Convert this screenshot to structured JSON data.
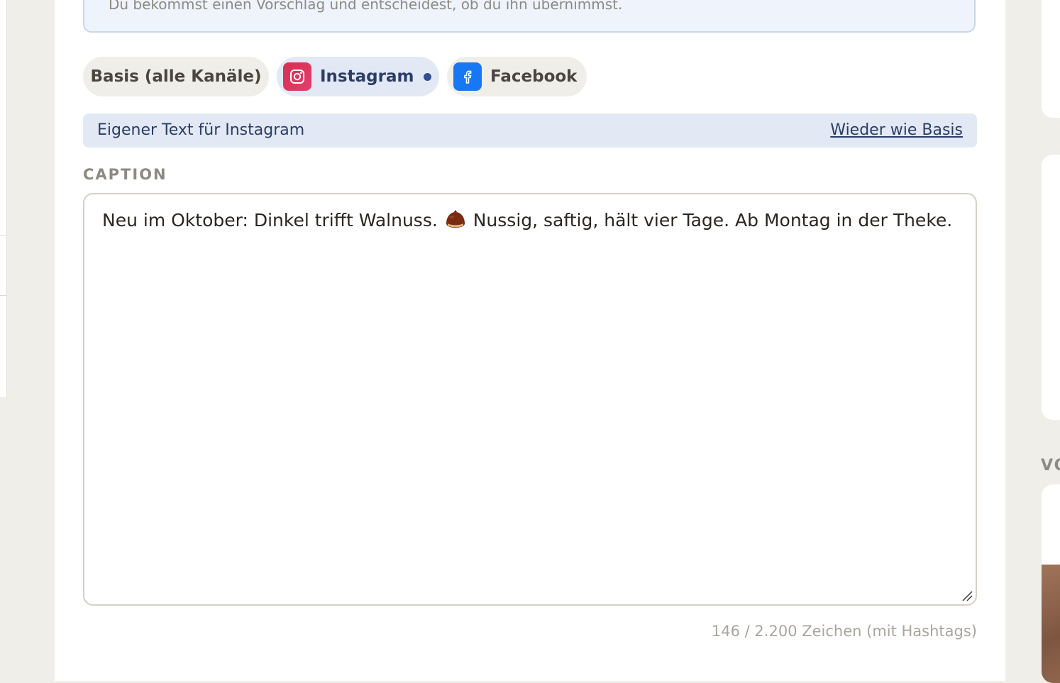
{
  "info_box": {
    "text": "Du bekommst einen Vorschlag und entscheidest, ob du ihn übernimmst."
  },
  "channels": {
    "basis": {
      "label": "Basis (alle Kanäle)"
    },
    "instagram": {
      "label": "Instagram",
      "icon": "instagram-icon",
      "has_changes": true
    },
    "facebook": {
      "label": "Facebook",
      "icon": "facebook-icon"
    }
  },
  "custom_text_bar": {
    "label": "Eigener Text für Instagram",
    "reset_link": "Wieder wie Basis"
  },
  "caption": {
    "label": "CAPTION",
    "text_before": "Neu im Oktober: Dinkel trifft Walnuss.",
    "emoji": "chestnut-emoji",
    "text_after": "Nussig, saftig, hält vier Tage. Ab Montag in der Theke."
  },
  "counter": "146 / 2.200 Zeichen (mit Hashtags)",
  "right_panel": {
    "heading_fragment": "VO"
  },
  "colors": {
    "accent": "#2b3d66",
    "instagram": "#e1306c",
    "facebook": "#1877f2",
    "background": "#f0eee9"
  }
}
